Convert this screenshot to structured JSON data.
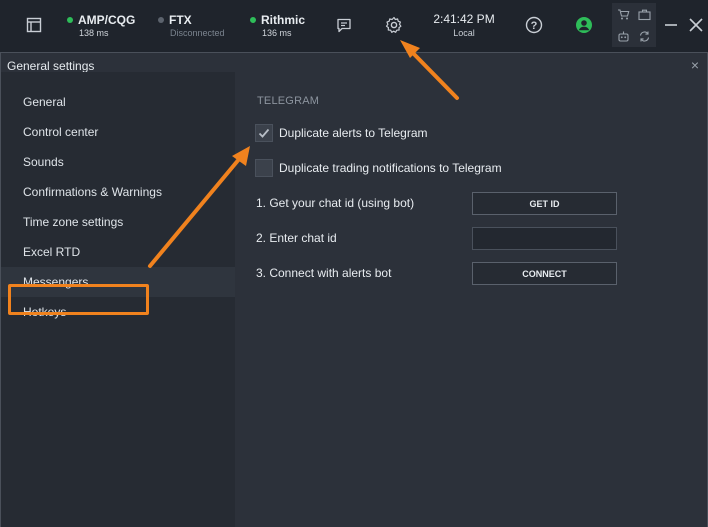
{
  "topbar": {
    "connections": [
      {
        "name": "AMP/CQG",
        "sub": "138 ms",
        "status_color": "#2ebd59"
      },
      {
        "name": "FTX",
        "sub": "Disconnected",
        "status_color": "#5c636d"
      },
      {
        "name": "Rithmic",
        "sub": "136 ms",
        "status_color": "#2ebd59"
      }
    ],
    "clock": {
      "time": "2:41:42 PM",
      "zone": "Local"
    },
    "user_color": "#2ebd59"
  },
  "dialog": {
    "title": "General settings",
    "close": "×"
  },
  "sidebar": {
    "items": [
      {
        "label": "General"
      },
      {
        "label": "Control center"
      },
      {
        "label": "Sounds"
      },
      {
        "label": "Confirmations & Warnings"
      },
      {
        "label": "Time zone settings"
      },
      {
        "label": "Excel RTD"
      },
      {
        "label": "Messengers"
      },
      {
        "label": "Hotkeys"
      }
    ],
    "selected": "Messengers"
  },
  "telegram": {
    "section": "TELEGRAM",
    "dup_alerts": {
      "label": "Duplicate alerts to Telegram",
      "checked": true
    },
    "dup_trading": {
      "label": "Duplicate trading notifications to Telegram",
      "checked": false
    },
    "step1": "1. Get your chat id (using bot)",
    "get_id": "GET ID",
    "step2": "2. Enter chat id",
    "chat_id_value": "",
    "step3": "3. Connect with alerts bot",
    "connect": "CONNECT"
  },
  "colors": {
    "accent": "#f0821e"
  }
}
